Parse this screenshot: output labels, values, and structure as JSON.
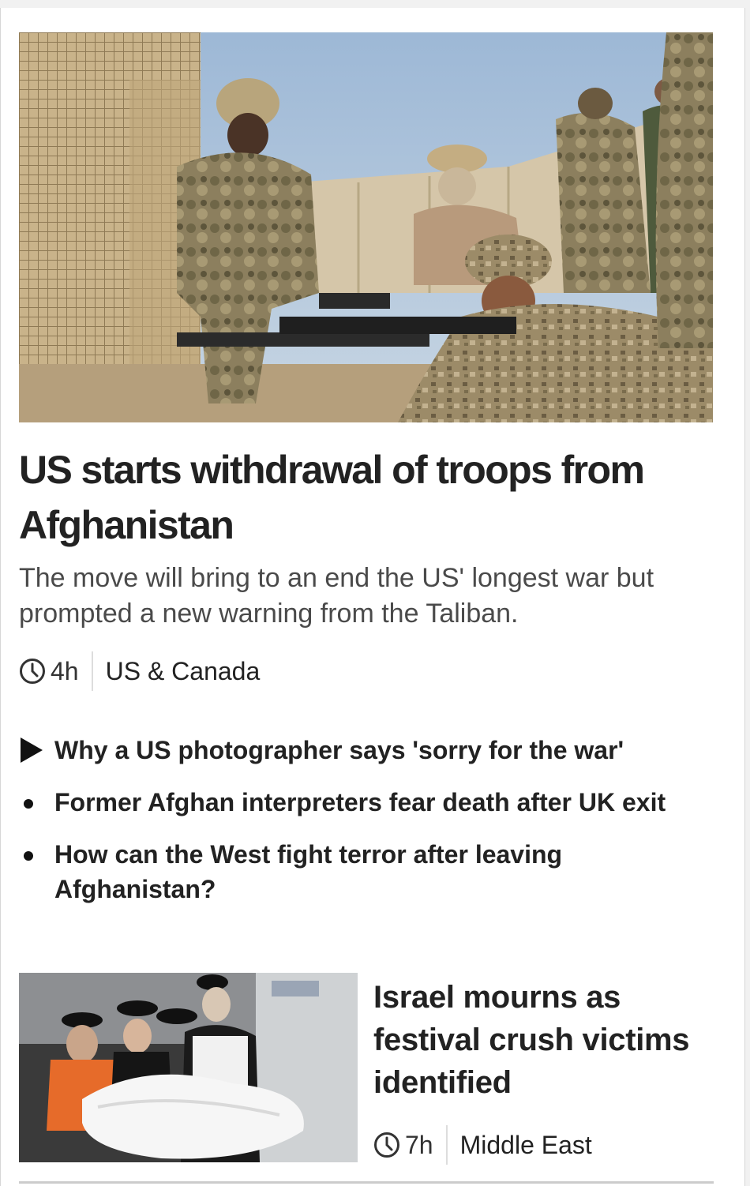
{
  "lead_story": {
    "image_alt": "Soldiers training with rifles at a base",
    "headline": "US starts withdrawal of troops from Afghanistan",
    "summary": "The move will bring to an end the US' longest war but prompted a new warning from the Taliban.",
    "time": "4h",
    "section": "US & Canada"
  },
  "related_links": [
    {
      "type": "video",
      "label": "Why a US photographer says 'sorry for the war'"
    },
    {
      "type": "article",
      "label": "Former Afghan interpreters fear death after UK exit"
    },
    {
      "type": "article",
      "label": "How can the West fight terror after leaving Afghanistan?"
    }
  ],
  "second_story": {
    "image_alt": "Mourners around a covered body",
    "headline": "Israel mourns as festival crush victims identified",
    "time": "7h",
    "section": "Middle East"
  },
  "icons": {
    "clock": "clock-icon",
    "play": "play-icon",
    "bullet": "bullet-icon"
  },
  "colors": {
    "headline": "#222222",
    "summary": "#4a4a4a",
    "divider": "#dddddd"
  }
}
